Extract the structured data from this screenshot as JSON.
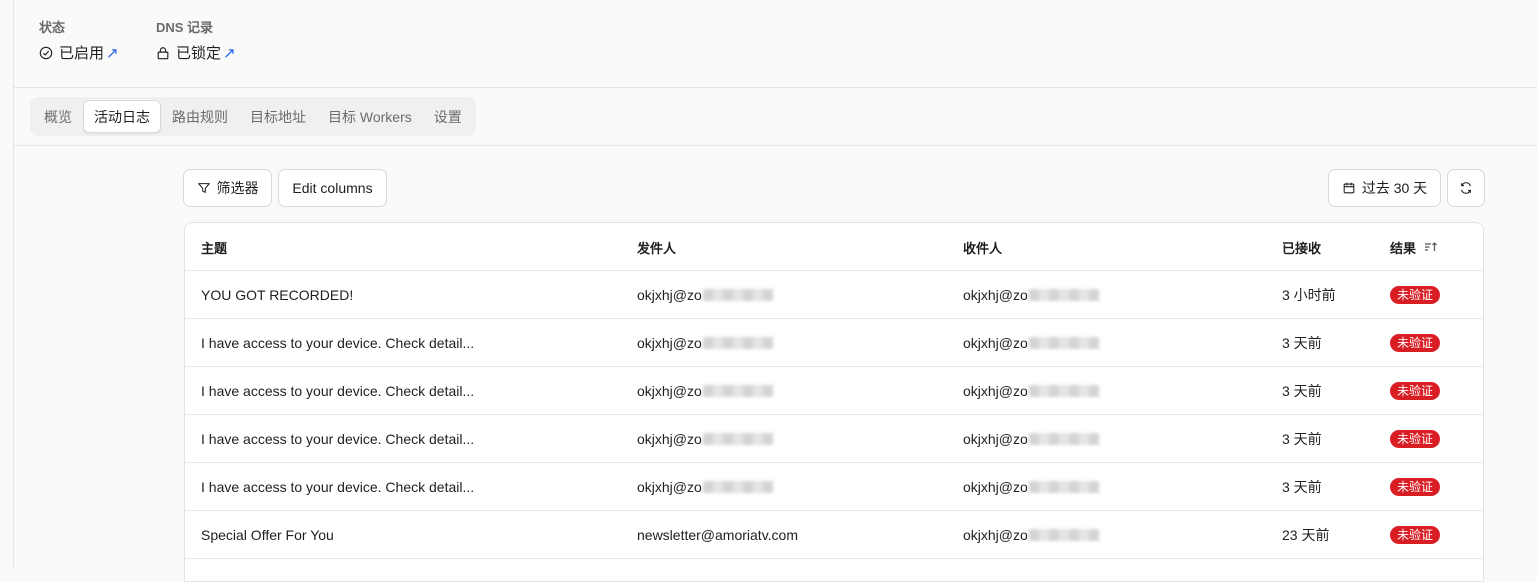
{
  "status": {
    "label": "状态",
    "value": "已启用",
    "link_glyph": "↗"
  },
  "dns": {
    "label": "DNS 记录",
    "value": "已锁定",
    "link_glyph": "↗"
  },
  "tabs": [
    {
      "label": "概览",
      "active": false
    },
    {
      "label": "活动日志",
      "active": true
    },
    {
      "label": "路由规则",
      "active": false
    },
    {
      "label": "目标地址",
      "active": false
    },
    {
      "label": "目标 Workers",
      "active": false
    },
    {
      "label": "设置",
      "active": false
    }
  ],
  "toolbar": {
    "filter_label": "筛选器",
    "edit_columns_label": "Edit columns",
    "date_range_label": "过去 30 天"
  },
  "table": {
    "headers": {
      "subject": "主题",
      "from": "发件人",
      "to": "收件人",
      "received": "已接收",
      "result": "结果"
    },
    "rows": [
      {
        "subject": "YOU GOT RECORDED!",
        "from": "okjxhj@zo",
        "from_redacted": true,
        "to": "okjxhj@zo",
        "received": "3 小时前",
        "result": "未验证"
      },
      {
        "subject": "I have access to your device. Check detail...",
        "from": "okjxhj@zo",
        "from_redacted": true,
        "to": "okjxhj@zo",
        "received": "3 天前",
        "result": "未验证"
      },
      {
        "subject": "I have access to your device. Check detail...",
        "from": "okjxhj@zo",
        "from_redacted": true,
        "to": "okjxhj@zo",
        "received": "3 天前",
        "result": "未验证"
      },
      {
        "subject": "I have access to your device. Check detail...",
        "from": "okjxhj@zo",
        "from_redacted": true,
        "to": "okjxhj@zo",
        "received": "3 天前",
        "result": "未验证"
      },
      {
        "subject": "I have access to your device. Check detail...",
        "from": "okjxhj@zo",
        "from_redacted": true,
        "to": "okjxhj@zo",
        "received": "3 天前",
        "result": "未验证"
      },
      {
        "subject": "Special Offer For You",
        "from": "newsletter@amoriatv.com",
        "from_redacted": false,
        "to": "okjxhj@zo",
        "received": "23 天前",
        "result": "未验证"
      }
    ]
  },
  "colors": {
    "badge_unverified": "#d91d24",
    "link": "#2563eb"
  }
}
